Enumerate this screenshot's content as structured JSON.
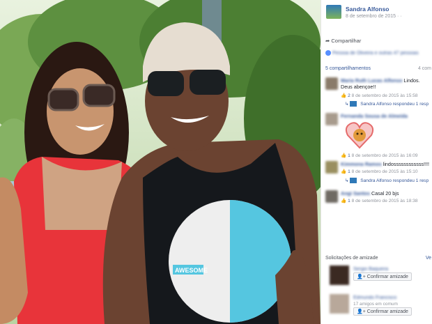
{
  "post": {
    "author": "Sandra Alfonso",
    "date": "8 de setembro de 2015 · ·"
  },
  "actions": {
    "share": "Compartilhar"
  },
  "likes": {
    "text": "Pessoa de Oliveira e outras 47 pessoas"
  },
  "shares": {
    "count": "5 compartilhamentos",
    "right": "4 com"
  },
  "comments": [
    {
      "author": "Maria Ruth Lucas Alfonso",
      "text": "Lindos. Deus abençoe!!",
      "likes": "2",
      "date": "8 de setembro de 2015 às 15:58",
      "reply_author": "Sandra Alfonso respondeu",
      "reply_count": "1 resp"
    },
    {
      "author": "Fernanda Sousa de Almeida",
      "text": "",
      "likes": "1",
      "date": "8 de setembro de 2015 às 16:09"
    },
    {
      "author": "Kimmona Ramos",
      "text": "lindossssssssssss!!!!",
      "likes": "1",
      "date": "8 de setembro de 2015 às 15:10",
      "reply_author": "Sandra Alfonso respondeu",
      "reply_count": "1 resp"
    },
    {
      "author": "Angi Santos",
      "text": "Casal 20 bjs",
      "likes": "1",
      "date": "8 de setembro de 2015 às 18:38"
    }
  ],
  "friend_requests": {
    "title": "Solicitações de amizade",
    "right": "Ve",
    "items": [
      {
        "name": "Sergio Baqueira",
        "mutual": "",
        "button": "Confirmar amizade"
      },
      {
        "name": "Edmundo Francisco",
        "mutual": "17 amigos em comum",
        "button": "Confirmar amizade"
      }
    ]
  },
  "photo": {
    "shirt_text": "AWESOME"
  },
  "colors": {
    "link": "#365899",
    "meta": "#90949c",
    "shirt": "#55c6e0"
  }
}
